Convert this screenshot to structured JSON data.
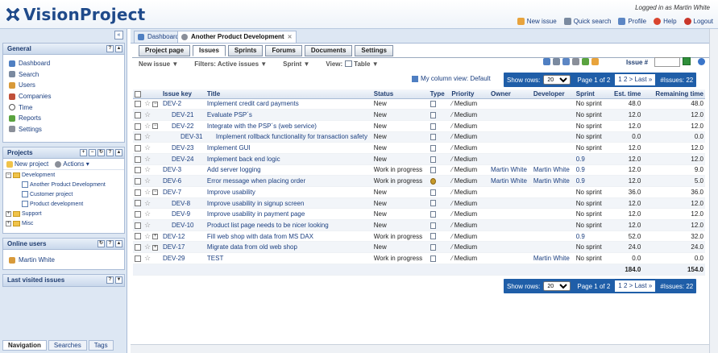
{
  "header": {
    "logo_text": "VisionProject",
    "logged_in": "Logged in as Martin White",
    "links": [
      "New issue",
      "Quick search",
      "Profile",
      "Help",
      "Logout"
    ]
  },
  "sidebar": {
    "general_title": "General",
    "nav": [
      "Dashboard",
      "Search",
      "Users",
      "Companies",
      "Time",
      "Reports",
      "Settings"
    ],
    "projects_title": "Projects",
    "new_project": "New project",
    "actions": "Actions ▾",
    "tree": {
      "development": "Development",
      "projects": [
        "Another Product Development",
        "Customer project",
        "Product development"
      ],
      "support": "Support",
      "misc": "Misc"
    },
    "online_title": "Online users",
    "online_user": "Martin White",
    "last_visited_title": "Last visited issues",
    "bottom_tabs": [
      "Navigation",
      "Searches",
      "Tags"
    ]
  },
  "doctabs": {
    "dashboard": "Dashboard",
    "project": "Another Product Development"
  },
  "project_tabs": [
    "Project page",
    "Issues",
    "Sprints",
    "Forums",
    "Documents",
    "Settings"
  ],
  "toolbar": {
    "new_issue": "New issue ▼",
    "filters": "Filters: Active issues ▼",
    "sprint": "Sprint ▼",
    "view_label": "View:",
    "view_value": "Table ▼",
    "issue_num_label": "Issue #"
  },
  "column_view": "My column view: Default",
  "pager": {
    "show_rows": "Show rows:",
    "rows_value": "20",
    "page_of": "Page 1 of 2",
    "pages": "1 2 > Last »",
    "count": "#Issues: 22"
  },
  "table": {
    "headers": [
      "Issue key",
      "Title",
      "Status",
      "Type",
      "Priority",
      "Owner",
      "Developer",
      "Sprint",
      "Est. time",
      "Remaining time"
    ],
    "rows": [
      {
        "exp": "⊟",
        "key": "DEV-2",
        "title": "Implement credit card payments",
        "status": "New",
        "type": "doc",
        "priority": "Medium",
        "owner": "",
        "developer": "",
        "sprint": "No sprint",
        "est": "48.0",
        "rem": "48.0",
        "indent": 0
      },
      {
        "exp": "",
        "key": "DEV-21",
        "title": "Evaluate PSP´s",
        "status": "New",
        "type": "doc",
        "priority": "Medium",
        "owner": "",
        "developer": "",
        "sprint": "No sprint",
        "est": "12.0",
        "rem": "12.0",
        "indent": 1
      },
      {
        "exp": "⊟",
        "key": "DEV-22",
        "title": "Integrate with the PSP´s (web service)",
        "status": "New",
        "type": "doc",
        "priority": "Medium",
        "owner": "",
        "developer": "",
        "sprint": "No sprint",
        "est": "12.0",
        "rem": "12.0",
        "indent": 1
      },
      {
        "exp": "",
        "key": "DEV-31",
        "title": "Implement rollback functionality for transaction safety",
        "status": "New",
        "type": "doc",
        "priority": "Medium",
        "owner": "",
        "developer": "",
        "sprint": "No sprint",
        "est": "0.0",
        "rem": "0.0",
        "indent": 2
      },
      {
        "exp": "",
        "key": "DEV-23",
        "title": "Implement GUI",
        "status": "New",
        "type": "doc",
        "priority": "Medium",
        "owner": "",
        "developer": "",
        "sprint": "No sprint",
        "est": "12.0",
        "rem": "12.0",
        "indent": 1
      },
      {
        "exp": "",
        "key": "DEV-24",
        "title": "Implement back end logic",
        "status": "New",
        "type": "doc",
        "priority": "Medium",
        "owner": "",
        "developer": "",
        "sprint": "0.9",
        "est": "12.0",
        "rem": "12.0",
        "indent": 1
      },
      {
        "exp": "",
        "key": "DEV-3",
        "title": "Add server logging",
        "status": "Work in progress",
        "type": "doc",
        "priority": "Medium",
        "owner": "Martin White",
        "developer": "Martin White",
        "sprint": "0.9",
        "est": "12.0",
        "rem": "9.0",
        "indent": 0
      },
      {
        "exp": "",
        "key": "DEV-6",
        "title": "Error message when placing order",
        "status": "Work in progress",
        "type": "bug",
        "priority": "Medium",
        "owner": "Martin White",
        "developer": "Martin White",
        "sprint": "0.9",
        "est": "12.0",
        "rem": "5.0",
        "indent": 0
      },
      {
        "exp": "⊟",
        "key": "DEV-7",
        "title": "Improve usability",
        "status": "New",
        "type": "doc",
        "priority": "Medium",
        "owner": "",
        "developer": "",
        "sprint": "No sprint",
        "est": "36.0",
        "rem": "36.0",
        "indent": 0
      },
      {
        "exp": "",
        "key": "DEV-8",
        "title": "Improve usability in signup screen",
        "status": "New",
        "type": "doc",
        "priority": "Medium",
        "owner": "",
        "developer": "",
        "sprint": "No sprint",
        "est": "12.0",
        "rem": "12.0",
        "indent": 1
      },
      {
        "exp": "",
        "key": "DEV-9",
        "title": "Improve usability in payment page",
        "status": "New",
        "type": "doc",
        "priority": "Medium",
        "owner": "",
        "developer": "",
        "sprint": "No sprint",
        "est": "12.0",
        "rem": "12.0",
        "indent": 1
      },
      {
        "exp": "",
        "key": "DEV-10",
        "title": "Product list page needs to be nicer looking",
        "status": "New",
        "type": "doc",
        "priority": "Medium",
        "owner": "",
        "developer": "",
        "sprint": "No sprint",
        "est": "12.0",
        "rem": "12.0",
        "indent": 1
      },
      {
        "exp": "⊞",
        "key": "DEV-12",
        "title": "Fill web shop with data from MS DAX",
        "status": "Work in progress",
        "type": "doc",
        "priority": "Medium",
        "owner": "",
        "developer": "",
        "sprint": "0.9",
        "est": "52.0",
        "rem": "32.0",
        "indent": 0
      },
      {
        "exp": "⊞",
        "key": "DEV-17",
        "title": "Migrate data from old web shop",
        "status": "New",
        "type": "doc",
        "priority": "Medium",
        "owner": "",
        "developer": "",
        "sprint": "No sprint",
        "est": "24.0",
        "rem": "24.0",
        "indent": 0
      },
      {
        "exp": "",
        "key": "DEV-29",
        "title": "TEST",
        "status": "Work in progress",
        "type": "doc",
        "priority": "Medium",
        "owner": "",
        "developer": "Martin White",
        "sprint": "No sprint",
        "est": "0.0",
        "rem": "0.0",
        "indent": 0
      }
    ],
    "total_est": "184.0",
    "total_rem": "154.0"
  }
}
